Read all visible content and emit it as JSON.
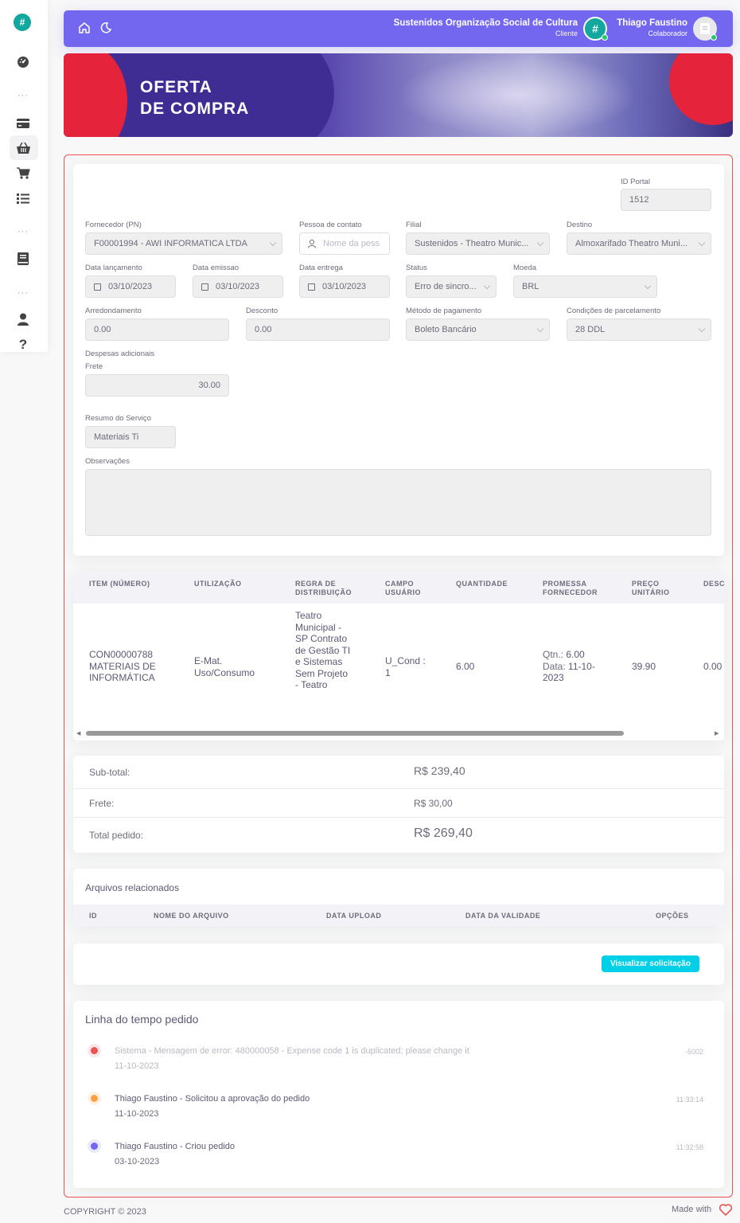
{
  "navbar": {
    "org_name": "Sustenidos Organização Social de Cultura",
    "org_role": "Cliente",
    "user_name": "Thiago Faustino",
    "user_role": "Colaborador"
  },
  "banner": {
    "line1": "OFERTA",
    "line2": "DE COMPRA"
  },
  "form": {
    "id_portal": {
      "label": "ID Portal",
      "value": "1512"
    },
    "fornecedor": {
      "label": "Fornecedor (PN)",
      "value": "F00001994 - AWI INFORMATICA LTDA"
    },
    "pessoa_contato": {
      "label": "Pessoa de contato",
      "placeholder": "Nome da pess"
    },
    "filial": {
      "label": "Filial",
      "value": "Sustenidos - Theatro Munic..."
    },
    "destino": {
      "label": "Destino",
      "value": "Almoxarifado Theatro Muni..."
    },
    "data_lancamento": {
      "label": "Data lançamento",
      "value": "03/10/2023"
    },
    "data_emissao": {
      "label": "Data emissao",
      "value": "03/10/2023"
    },
    "data_entrega": {
      "label": "Data entrega",
      "value": "03/10/2023"
    },
    "status": {
      "label": "Status",
      "value": "Erro de sincro..."
    },
    "moeda": {
      "label": "Moeda",
      "value": "BRL"
    },
    "arredondamento": {
      "label": "Arredondamento",
      "value": "0.00"
    },
    "desconto": {
      "label": "Desconto",
      "value": "0.00"
    },
    "metodo_pagamento": {
      "label": "Método de pagamento",
      "value": "Boleto Bancário"
    },
    "condicoes": {
      "label": "Condições de parcelamento",
      "value": "28 DDL"
    },
    "despesas_label": "Despesas adicionais",
    "frete": {
      "label": "Frete",
      "value": "30.00"
    },
    "resumo": {
      "label": "Resumo do Serviço",
      "value": "Materiais Ti"
    },
    "observacoes": {
      "label": "Observações",
      "value": ""
    }
  },
  "items_table": {
    "headers": [
      "ITEM (NÚMERO)",
      "UTILIZAÇÃO",
      "REGRA DE DISTRIBUIÇÃO",
      "CAMPO USUÁRIO",
      "QUANTIDADE",
      "PROMESSA FORNECEDOR",
      "PREÇO UNITÁRIO",
      "DESC"
    ],
    "row": {
      "item": "CON00000788 MATERIAIS DE INFORMÁTICA",
      "utilizacao": "E-Mat. Uso/Consumo",
      "regra": "Teatro Municipal - SP Contrato de Gestão TI e Sistemas Sem Projeto - Teatro",
      "campo_usuario": "U_Cond : 1",
      "quantidade": "6.00",
      "promessa_qtn_label": "Qtn.:",
      "promessa_qtn": "6.00",
      "promessa_data_label": "Data:",
      "promessa_data": "11-10-2023",
      "preco": "39.90",
      "desconto": "0.00"
    }
  },
  "totals": {
    "subtotal_label": "Sub-total:",
    "subtotal": "R$ 239,40",
    "frete_label": "Frete:",
    "frete": "R$ 30,00",
    "total_label": "Total pedido:",
    "total": "R$ 269,40"
  },
  "files": {
    "title": "Arquivos relacionados",
    "headers": [
      "ID",
      "NOME DO ARQUIVO",
      "DATA UPLOAD",
      "DATA DA VALIDADE",
      "OPÇÕES"
    ]
  },
  "actions": {
    "view_button": "Visualizar solicitação"
  },
  "timeline": {
    "title": "Linha do tempo pedido",
    "events": [
      {
        "text": "Sistema - Mensagem de error: 480000058 - Expense code 1 is duplicated; please change it",
        "date": "11-10-2023",
        "time": "-5002",
        "color": "#ea5455"
      },
      {
        "text": "Thiago Faustino - Solicitou a aprovação do pedido",
        "date": "11-10-2023",
        "time": "11:33:14",
        "color": "#ff9f43"
      },
      {
        "text": "Thiago Faustino - Criou pedido",
        "date": "03-10-2023",
        "time": "11:32:58",
        "color": "#7367f0"
      }
    ]
  },
  "footer": {
    "copyright": "COPYRIGHT © 2023",
    "made_with": "Made with"
  }
}
